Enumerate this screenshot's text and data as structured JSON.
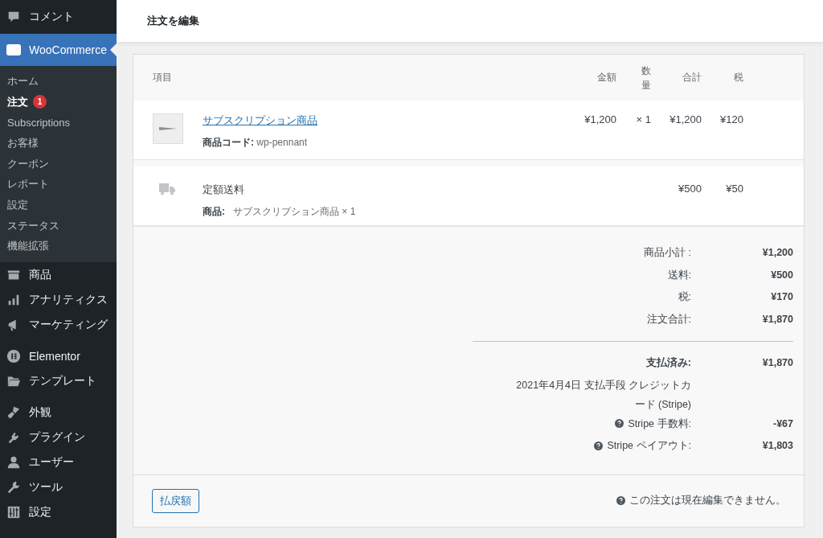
{
  "sidebar": {
    "items": [
      {
        "kind": "menu",
        "label": "コメント",
        "selected": false
      },
      {
        "kind": "menu",
        "label": "WooCommerce",
        "selected": true,
        "children": [
          {
            "label": "ホーム",
            "selected": false
          },
          {
            "label": "注文",
            "selected": true,
            "badge": "1"
          },
          {
            "label": "Subscriptions",
            "selected": false
          },
          {
            "label": "お客様",
            "selected": false
          },
          {
            "label": "クーポン",
            "selected": false
          },
          {
            "label": "レポート",
            "selected": false
          },
          {
            "label": "設定",
            "selected": false
          },
          {
            "label": "ステータス",
            "selected": false
          },
          {
            "label": "機能拡張",
            "selected": false
          }
        ]
      },
      {
        "kind": "menu",
        "label": "商品",
        "selected": false
      },
      {
        "kind": "menu",
        "label": "アナリティクス",
        "selected": false
      },
      {
        "kind": "menu",
        "label": "マーケティング",
        "selected": false
      },
      {
        "kind": "separator"
      },
      {
        "kind": "menu",
        "label": "Elementor",
        "selected": false
      },
      {
        "kind": "menu",
        "label": "テンプレート",
        "selected": false
      },
      {
        "kind": "separator"
      },
      {
        "kind": "menu",
        "label": "外観",
        "selected": false
      },
      {
        "kind": "menu",
        "label": "プラグイン",
        "selected": false
      },
      {
        "kind": "menu",
        "label": "ユーザー",
        "selected": false
      },
      {
        "kind": "menu",
        "label": "ツール",
        "selected": false
      },
      {
        "kind": "menu",
        "label": "設定",
        "selected": false
      }
    ]
  },
  "header": {
    "title": "注文を編集"
  },
  "items_table": {
    "columns": [
      "項目",
      "金額",
      "数量",
      "合計",
      "税"
    ],
    "rows": [
      {
        "kind": "product",
        "name": "サブスクリプション商品",
        "meta_label": "商品コード:",
        "meta_value": "wp-pennant",
        "cost": "¥1,200",
        "qty": "× 1",
        "total": "¥1,200",
        "tax": "¥120"
      },
      {
        "kind": "shipping",
        "name": "定額送料",
        "meta_label": "商品:",
        "meta_value": "サブスクリプション商品 × 1",
        "total": "¥500",
        "tax": "¥50"
      }
    ]
  },
  "totals": {
    "rows": [
      {
        "label": "商品小計 :",
        "value": "¥1,200"
      },
      {
        "label": "送料:",
        "value": "¥500"
      },
      {
        "label": "税:",
        "value": "¥170"
      },
      {
        "label": "注文合計:",
        "value": "¥1,870"
      }
    ],
    "paid": {
      "label": "支払済み:",
      "value": "¥1,870",
      "note": "2021年4月4日 支払手段 クレジットカード (Stripe)"
    },
    "fees": [
      {
        "label": "Stripe 手数料:",
        "value": "-¥67"
      },
      {
        "label": "Stripe ペイアウト:",
        "value": "¥1,803"
      }
    ]
  },
  "footer": {
    "refund_button": "払戻額",
    "notice": "この注文は現在編集できません。"
  }
}
